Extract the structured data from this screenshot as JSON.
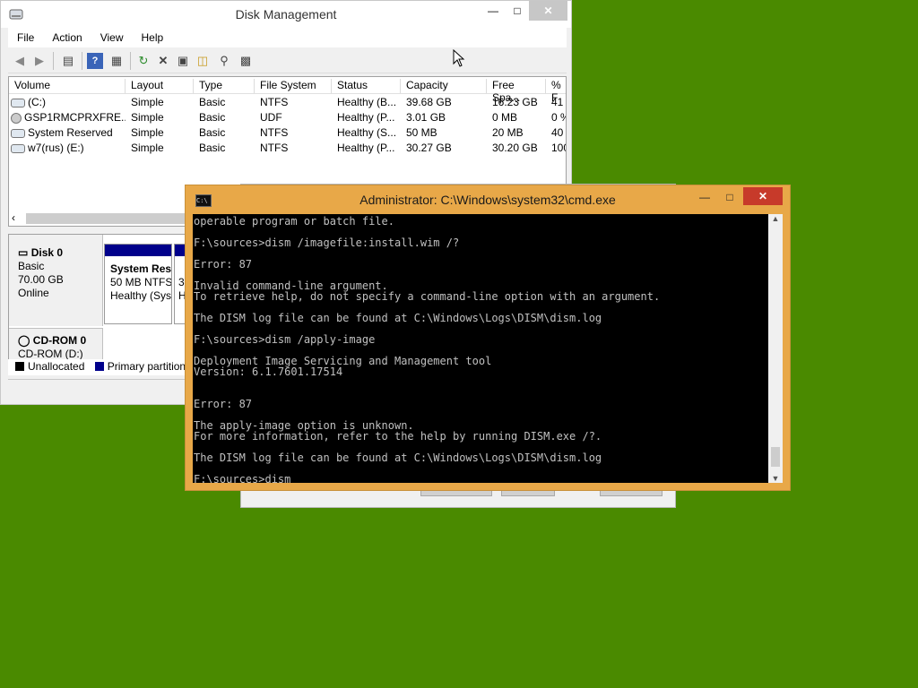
{
  "disk_mgmt": {
    "title": "Disk Management",
    "menu": [
      "File",
      "Action",
      "View",
      "Help"
    ],
    "list_headers": [
      "Volume",
      "Layout",
      "Type",
      "File System",
      "Status",
      "Capacity",
      "Free Spa...",
      "% F"
    ],
    "rows": [
      [
        "(C:)",
        "Simple",
        "Basic",
        "NTFS",
        "Healthy (B...",
        "39.68 GB",
        "16.23 GB",
        "41"
      ],
      [
        "GSP1RMCPRXFRE...",
        "Simple",
        "Basic",
        "UDF",
        "Healthy (P...",
        "3.01 GB",
        "0 MB",
        "0 %"
      ],
      [
        "System Reserved",
        "Simple",
        "Basic",
        "NTFS",
        "Healthy (S...",
        "50 MB",
        "20 MB",
        "40"
      ],
      [
        "w7(rus) (E:)",
        "Simple",
        "Basic",
        "NTFS",
        "Healthy (P...",
        "30.27 GB",
        "30.20 GB",
        "100"
      ]
    ],
    "disk0": {
      "name": "Disk 0",
      "type": "Basic",
      "size": "70.00 GB",
      "status": "Online"
    },
    "partition": {
      "name": "System Res",
      "detail": "50 MB NTFS",
      "health": "Healthy (Sys"
    },
    "part2_fragment": [
      "3",
      "H"
    ],
    "cdrom": {
      "name": "CD-ROM 0",
      "drive": "CD-ROM (D:)"
    },
    "legend": {
      "unallocated": "Unallocated",
      "primary": "Primary partition"
    },
    "colors": {
      "primary": "#00008b",
      "unallocated": "#000000"
    }
  },
  "cmd": {
    "title": "Administrator: C:\\Windows\\system32\\cmd.exe",
    "icon_text": "C:\\",
    "lines": [
      "operable program or batch file.",
      "",
      "F:\\sources>dism /imagefile:install.wim /?",
      "",
      "Error: 87",
      "",
      "Invalid command-line argument.",
      "To retrieve help, do not specify a command-line option with an argument.",
      "",
      "The DISM log file can be found at C:\\Windows\\Logs\\DISM\\dism.log",
      "",
      "F:\\sources>dism /apply-image",
      "",
      "Deployment Image Servicing and Management tool",
      "Version: 6.1.7601.17514",
      "",
      "",
      "Error: 87",
      "",
      "The apply-image option is unknown.",
      "For more information, refer to the help by running DISM.exe /?.",
      "",
      "The DISM log file can be found at C:\\Windows\\Logs\\DISM\\dism.log",
      "",
      "F:\\sources>dism"
    ],
    "colors": {
      "frame": "#e8a848",
      "close": "#c73a2a",
      "console_bg": "#000000",
      "console_fg": "#c0c0c0"
    }
  },
  "desktop": {
    "background": "#4a8a00"
  }
}
